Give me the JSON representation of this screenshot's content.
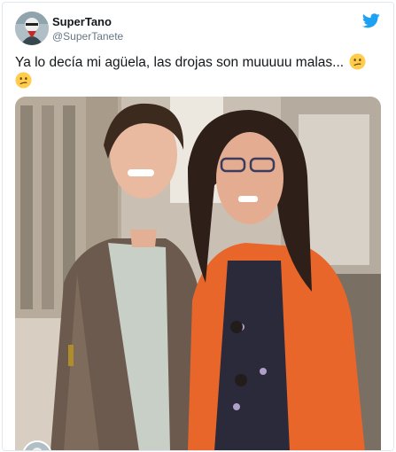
{
  "tweet": {
    "author": {
      "display_name": "SuperTano",
      "handle": "@SuperTanete"
    },
    "text": "Ya lo decía mi agüela, las drojas son muuuuu malas...",
    "emojis": [
      "confused-face",
      "confused-face"
    ],
    "platform_icon": "twitter-bird-icon",
    "accent_color": "#1da1f2",
    "media": {
      "kind": "photo",
      "description_icon": "photo"
    }
  }
}
